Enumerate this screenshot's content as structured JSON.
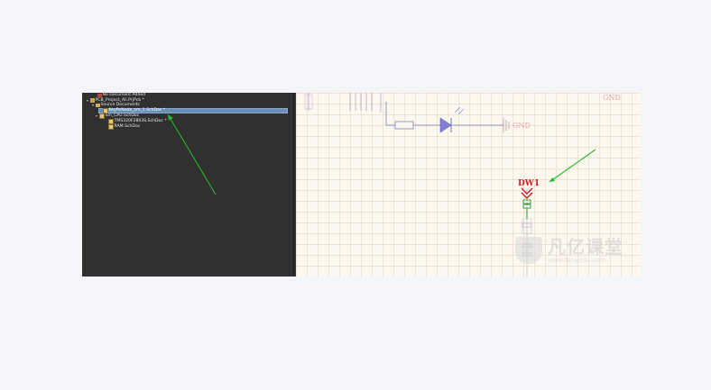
{
  "project_tree": {
    "items": [
      {
        "label": "No Document Added",
        "indent": 12,
        "icon": "red"
      },
      {
        "label": "PCB_Project_Ali.PrjPcb *",
        "indent": 4,
        "icon": "proj",
        "twisty": "▾"
      },
      {
        "label": "Source Documents",
        "indent": 10,
        "icon": "folder",
        "twisty": "▾"
      },
      {
        "label": "KeyPeNode_sm_1.SchDoc *",
        "indent": 18,
        "icon": "sch",
        "selected": true
      },
      {
        "label": "Sm_CPU.SchDoc",
        "indent": 14,
        "icon": "sch",
        "twisty": "▾"
      },
      {
        "label": "TMS320F2803S.SchDoc *",
        "indent": 24,
        "icon": "sch"
      },
      {
        "label": "RAM.SchDoc",
        "indent": 24,
        "icon": "sch"
      }
    ]
  },
  "schematic": {
    "net_labels": {
      "gnd_top_right": "GND",
      "gnd_power_port": "GND"
    },
    "designator": "DW1",
    "vertical_pin_labels": [
      "D1",
      "D2",
      "D3",
      "D4",
      "D5"
    ]
  },
  "watermark": {
    "brand": "凡亿课堂",
    "url": "www.fanyedu.com"
  },
  "colors": {
    "arrow": "#28b828",
    "panel_bg": "#303030",
    "selection": "#6b8fb5",
    "wire": "#8080c0",
    "designator": "#cc1f1f"
  }
}
